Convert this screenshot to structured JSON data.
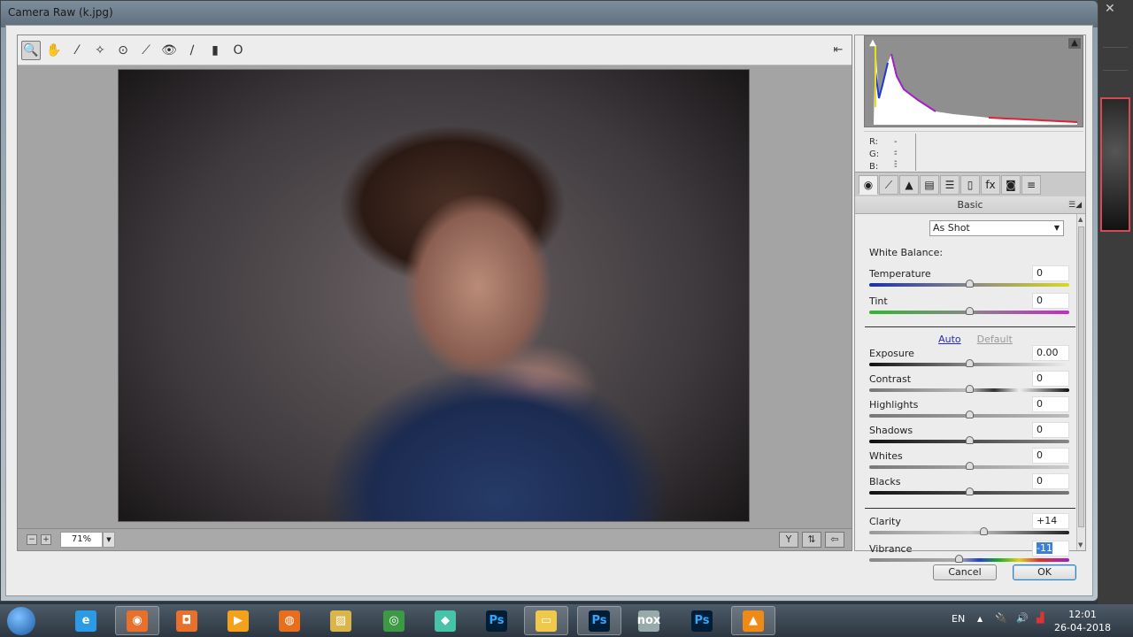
{
  "window": {
    "title": "Camera Raw (k.jpg)"
  },
  "toolbar": {
    "tools": [
      {
        "name": "zoom-tool",
        "glyph": "🔍",
        "active": true
      },
      {
        "name": "hand-tool",
        "glyph": "✋"
      },
      {
        "name": "white-balance-tool",
        "glyph": "⁄"
      },
      {
        "name": "color-sampler-tool",
        "glyph": "✧"
      },
      {
        "name": "targeted-adjustment-tool",
        "glyph": "⊙"
      },
      {
        "name": "straighten-tool",
        "glyph": "⟋"
      },
      {
        "name": "red-eye-removal-tool",
        "glyph": "👁"
      },
      {
        "name": "adjustment-brush-tool",
        "glyph": "∕"
      },
      {
        "name": "graduated-filter-tool",
        "glyph": "▮"
      },
      {
        "name": "radial-filter-tool",
        "glyph": "O"
      }
    ],
    "toggle_fullscreen_glyph": "⇤"
  },
  "preview": {
    "zoom_level": "71%",
    "zoom_out": "−",
    "zoom_in": "+",
    "view_buttons": [
      "Y",
      "⇅",
      "⇦"
    ]
  },
  "histogram": {
    "shadow_clip_glyph": "▲",
    "highlight_clip_glyph": "▲",
    "rgb": [
      {
        "label": "R:",
        "value": "---"
      },
      {
        "label": "G:",
        "value": "---"
      },
      {
        "label": "B:",
        "value": "---"
      }
    ]
  },
  "panel_tabs": [
    {
      "name": "basic",
      "glyph": "◉",
      "active": true
    },
    {
      "name": "tone-curve",
      "glyph": "⟋"
    },
    {
      "name": "detail",
      "glyph": "▲"
    },
    {
      "name": "hsl",
      "glyph": "▤"
    },
    {
      "name": "split-toning",
      "glyph": "☰"
    },
    {
      "name": "lens-corrections",
      "glyph": "▯"
    },
    {
      "name": "effects",
      "glyph": "fx"
    },
    {
      "name": "camera-calibration",
      "glyph": "◙"
    },
    {
      "name": "presets",
      "glyph": "≡"
    }
  ],
  "basic": {
    "section_title": "Basic",
    "section_menu": "☰◢",
    "white_balance_label": "White Balance:",
    "white_balance_value": "As Shot",
    "auto_label": "Auto",
    "default_label": "Default",
    "sliders": [
      {
        "label": "Temperature",
        "value": "0",
        "position": 0.5
      },
      {
        "label": "Tint",
        "value": "0",
        "position": 0.5
      },
      {
        "label": "Exposure",
        "value": "0.00",
        "position": 0.5
      },
      {
        "label": "Contrast",
        "value": "0",
        "position": 0.5
      },
      {
        "label": "Highlights",
        "value": "0",
        "position": 0.5
      },
      {
        "label": "Shadows",
        "value": "0",
        "position": 0.5
      },
      {
        "label": "Whites",
        "value": "0",
        "position": 0.5
      },
      {
        "label": "Blacks",
        "value": "0",
        "position": 0.5
      },
      {
        "label": "Clarity",
        "value": "+14",
        "position": 0.57
      },
      {
        "label": "Vibrance",
        "value": "-11",
        "position": 0.445,
        "selected": true
      }
    ]
  },
  "buttons": {
    "cancel": "Cancel",
    "ok": "OK"
  },
  "taskbar": {
    "items": [
      {
        "name": "internet-explorer",
        "glyph": "e",
        "color": "#2b9be6"
      },
      {
        "name": "screen-recorder",
        "glyph": "◉",
        "color": "#e8702a",
        "open": true
      },
      {
        "name": "screenshot-tool",
        "glyph": "◘",
        "color": "#e8702a"
      },
      {
        "name": "media-player",
        "glyph": "▶",
        "color": "#f4a21a"
      },
      {
        "name": "firefox",
        "glyph": "◍",
        "color": "#e76f1b"
      },
      {
        "name": "photo-viewer",
        "glyph": "▨",
        "color": "#d9b54a"
      },
      {
        "name": "chrome",
        "glyph": "◎",
        "color": "#3c9a44"
      },
      {
        "name": "filmora",
        "glyph": "◆",
        "color": "#46c3a8"
      },
      {
        "name": "photoshop-1",
        "glyph": "Ps",
        "color": "#31a8ff"
      },
      {
        "name": "file-explorer",
        "glyph": "▭",
        "color": "#f0c94a",
        "open": true
      },
      {
        "name": "photoshop-2",
        "glyph": "Ps",
        "color": "#31a8ff",
        "open": true
      },
      {
        "name": "nox",
        "glyph": "nox",
        "color": "#9aa"
      },
      {
        "name": "photoshop-3",
        "glyph": "Ps",
        "color": "#31a8ff"
      },
      {
        "name": "vlc",
        "glyph": "▲",
        "color": "#f08a17",
        "open": true
      }
    ],
    "language": "EN",
    "tray_expand": "▲",
    "clock_time": "12:01",
    "clock_date": "26-04-2018"
  }
}
